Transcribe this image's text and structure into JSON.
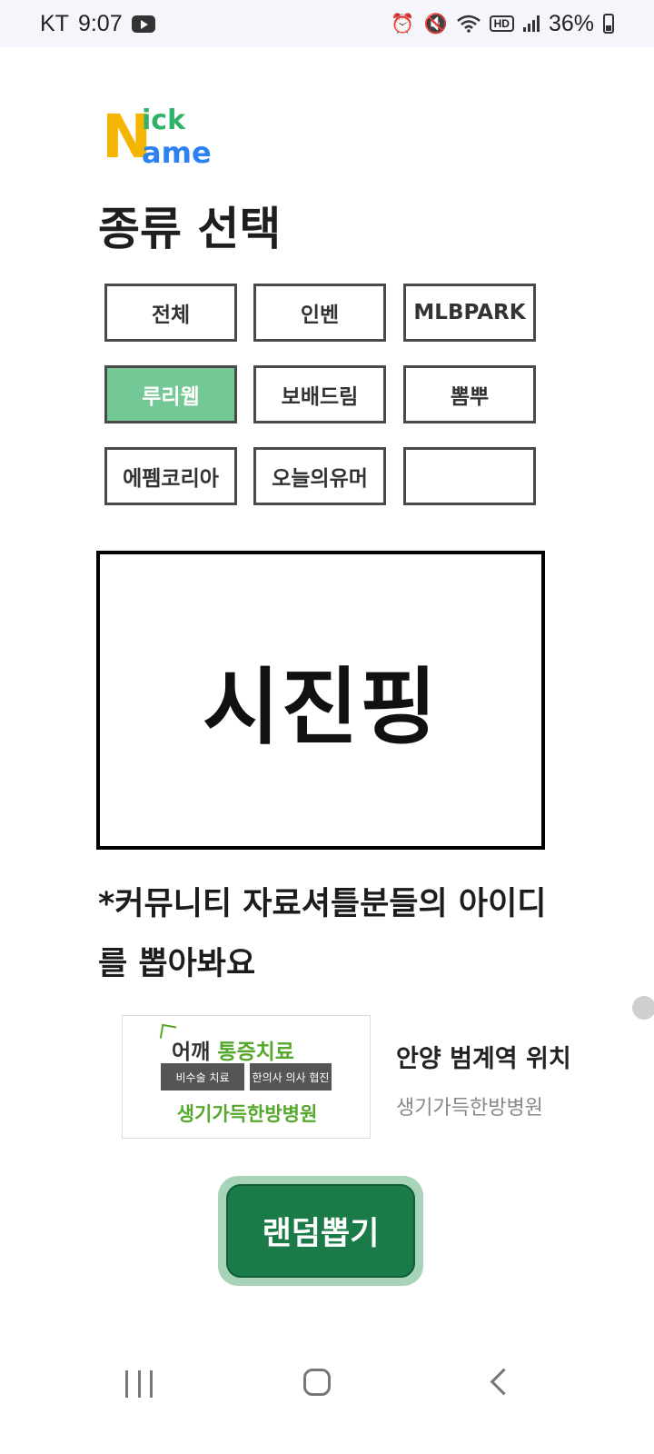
{
  "status_bar": {
    "carrier": "KT",
    "time": "9:07",
    "hd_badge": "HD",
    "battery_percent": "36%",
    "battery_level": 0.36,
    "icons": [
      "youtube-icon",
      "alarm-icon",
      "mute-icon",
      "wifi-icon",
      "hd-voice-icon",
      "signal-icon",
      "battery-icon"
    ]
  },
  "logo": {
    "letter_n": "N",
    "ick": "ick",
    "ame": "ame"
  },
  "section_title": "종류 선택",
  "categories": [
    {
      "label": "전체",
      "selected": false
    },
    {
      "label": "인벤",
      "selected": false
    },
    {
      "label": "MLBPARK",
      "selected": false
    },
    {
      "label": "루리웹",
      "selected": true
    },
    {
      "label": "보배드림",
      "selected": false
    },
    {
      "label": "뽐뿌",
      "selected": false
    },
    {
      "label": "에펨코리아",
      "selected": false
    },
    {
      "label": "오늘의유머",
      "selected": false
    },
    {
      "label": "",
      "selected": false
    }
  ],
  "result": "시진핑",
  "note": "*커뮤니티 자료셔틀분들의 아이디를 뽑아봐요",
  "ad": {
    "image": {
      "headline_plain": "어깨 ",
      "headline_green": "통증치료",
      "tag_1": "비수술 치료",
      "tag_2": "한의사 의사 협진",
      "subline": "생기가득한방병원"
    },
    "title": "안양 범계역 위치",
    "description": "생기가득한방병원"
  },
  "random_button": "랜덤뽑기",
  "colors": {
    "selected_category": "#74c896",
    "button_green": "#1a7a48",
    "button_border": "#a7d3b8",
    "logo_yellow": "#f4b400",
    "logo_green": "#2fb26a",
    "logo_blue": "#2b82f0"
  },
  "nav_icons": [
    "recent-apps-icon",
    "home-icon",
    "back-icon"
  ]
}
